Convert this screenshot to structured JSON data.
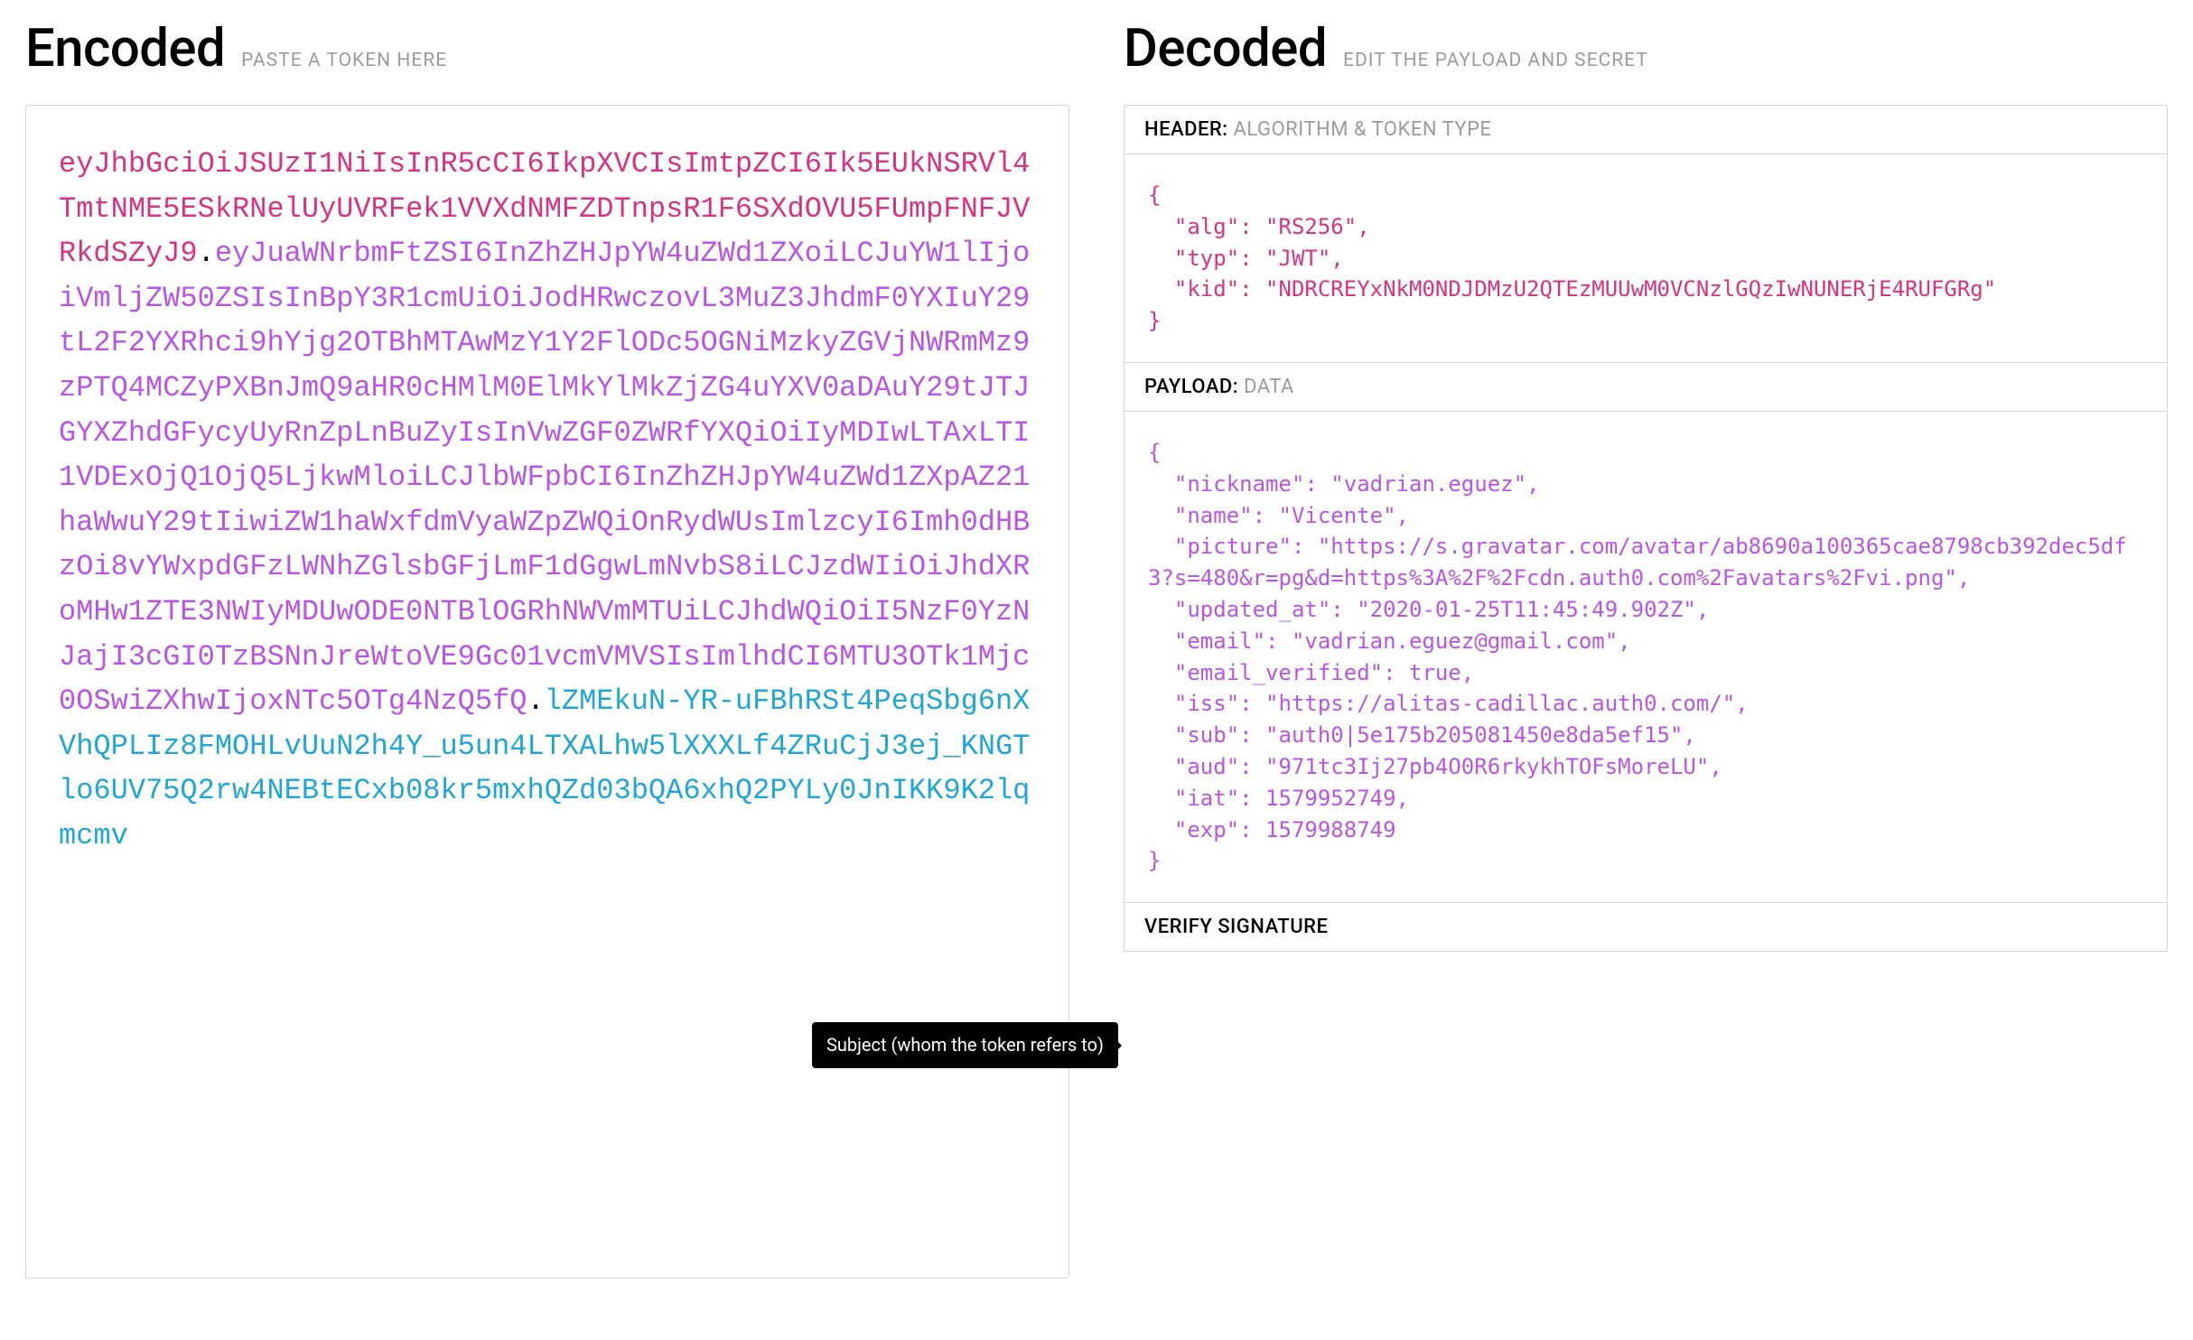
{
  "encoded": {
    "title": "Encoded",
    "subtitle": "PASTE A TOKEN HERE",
    "token_header": "eyJhbGciOiJSUzI1NiIsInR5cCI6IkpXVCIsImtpZCI6Ik5EUkNSRVl4TmtNME5ESkRNelUyUVRFek1VVXdNMFZDTnpsR1F6SXdOVU5FUmpFNFJVRkdSZyJ9",
    "token_payload": "eyJuaWNrbmFtZSI6InZhZHJpYW4uZWd1ZXoiLCJuYW1lIjoiVmljZW50ZSIsInBpY3R1cmUiOiJodHRwczovL3MuZ3JhdmF0YXIuY29tL2F2YXRhci9hYjg2OTBhMTAwMzY1Y2FlODc5OGNiMzkyZGVjNWRmMz9zPTQ4MCZyPXBnJmQ9aHR0cHMlM0ElMkYlMkZjZG4uYXV0aDAuY29tJTJGYXZhdGFycyUyRnZpLnBuZyIsInVwZGF0ZWRfYXQiOiIyMDIwLTAxLTI1VDExOjQ1OjQ5LjkwMloiLCJlbWFpbCI6InZhZHJpYW4uZWd1ZXpAZ21haWwuY29tIiwiZW1haWxfdmVyaWZpZWQiOnRydWUsImlzcyI6Imh0dHBzOi8vYWxpdGFzLWNhZGlsbGFjLmF1dGgwLmNvbS8iLCJzdWIiOiJhdXRoMHw1ZTE3NWIyMDUwODE0NTBlOGRhNWVmMTUiLCJhdWQiOiI5NzF0YzNJajI3cGI0TzBSNnJreWtoVE9Gc01vcmVMVSIsImlhdCI6MTU3OTk1Mjc0OSwiZXhwIjoxNTc5OTg4NzQ5fQ",
    "token_signature": "lZMEkuN-YR-uFBhRSt4PeqSbg6nXVhQPLIz8FMOHLvUuN2h4Y_u5un4LTXALhw5lXXXLf4ZRuCjJ3ej_KNGTlo6UV75Q2rw4NEBtECxb08kr5mxhQZd03bQA6xhQ2PYLy0JnIKK9K2lqmcmv"
  },
  "decoded": {
    "title": "Decoded",
    "subtitle": "EDIT THE PAYLOAD AND SECRET",
    "header_section": {
      "label_strong": "HEADER:",
      "label_light": "ALGORITHM & TOKEN TYPE",
      "content": "{\n  \"alg\": \"RS256\",\n  \"typ\": \"JWT\",\n  \"kid\": \"NDRCREYxNkM0NDJDMzU2QTEzMUUwM0VCNzlGQzIwNUNERjE4RUFGRg\"\n}"
    },
    "payload_section": {
      "label_strong": "PAYLOAD:",
      "label_light": "DATA",
      "content": "{\n  \"nickname\": \"vadrian.eguez\",\n  \"name\": \"Vicente\",\n  \"picture\": \"https://s.gravatar.com/avatar/ab8690a100365cae8798cb392dec5df3?s=480&r=pg&d=https%3A%2F%2Fcdn.auth0.com%2Favatars%2Fvi.png\",\n  \"updated_at\": \"2020-01-25T11:45:49.902Z\",\n  \"email\": \"vadrian.eguez@gmail.com\",\n  \"email_verified\": true,\n  \"iss\": \"https://alitas-cadillac.auth0.com/\",\n  \"sub\": \"auth0|5e175b205081450e8da5ef15\",\n  \"aud\": \"971tc3Ij27pb4O0R6rkykhTOFsMoreLU\",\n  \"iat\": 1579952749,\n  \"exp\": 1579988749\n}"
    },
    "signature_section": {
      "label_strong": "VERIFY SIGNATURE"
    }
  },
  "tooltip": {
    "text": "Subject (whom the token refers to)"
  }
}
